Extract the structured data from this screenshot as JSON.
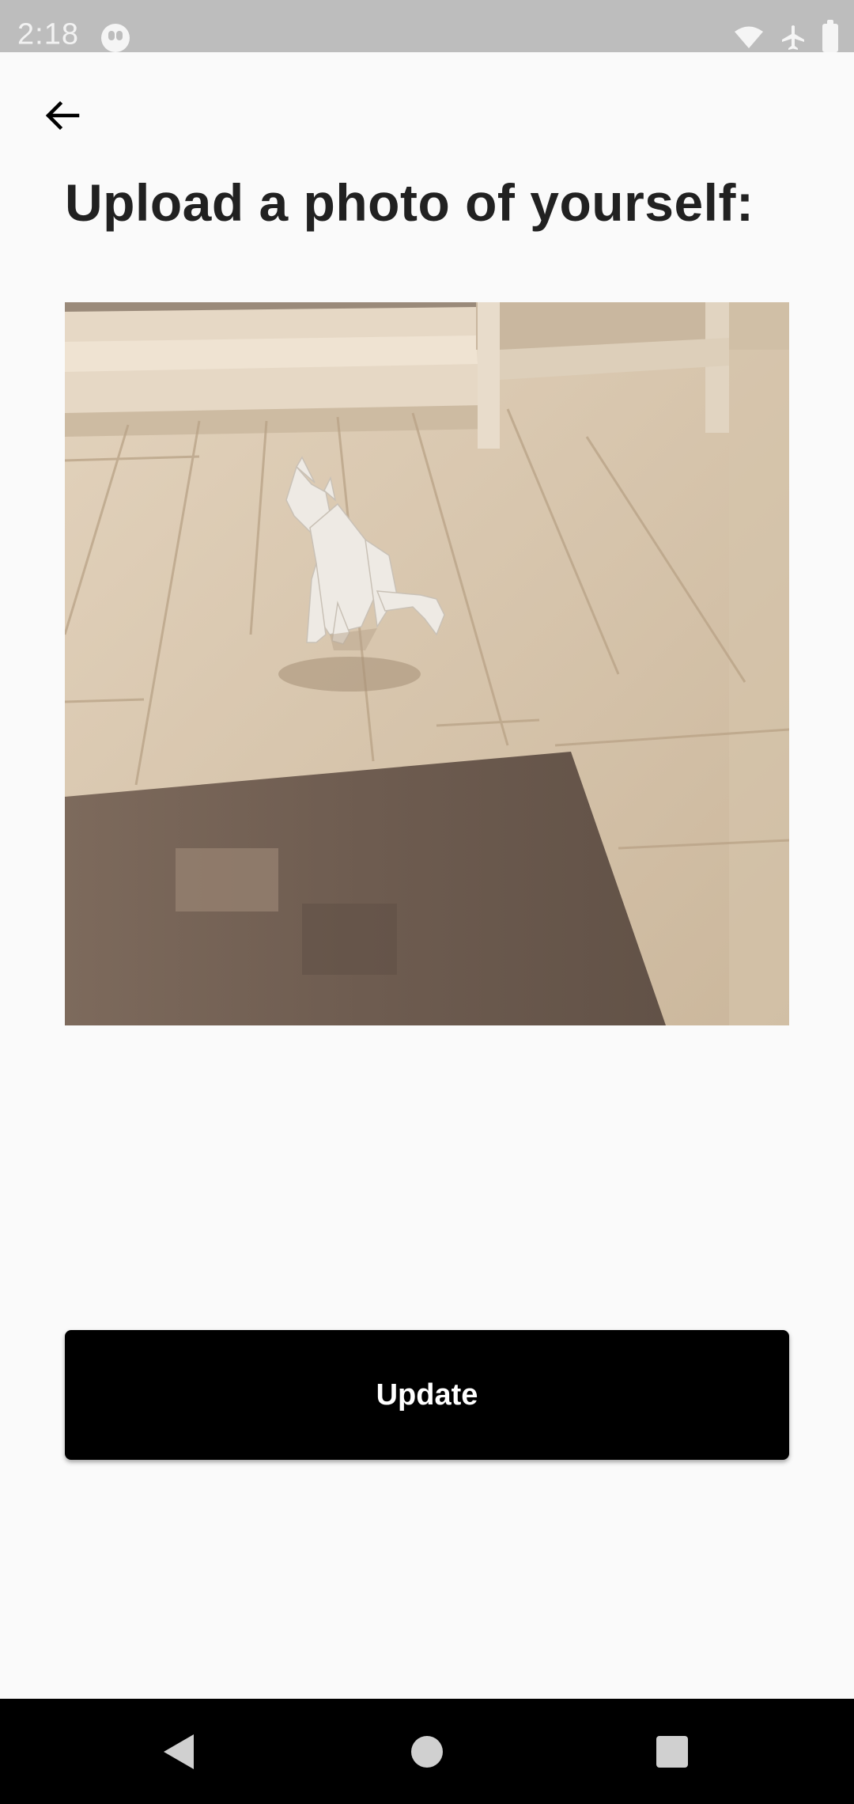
{
  "status_bar": {
    "time": "2:18",
    "icons": [
      "app-notification-icon",
      "wifi-icon",
      "airplane-mode-icon",
      "battery-icon"
    ]
  },
  "header": {
    "back_icon": "arrow-back-icon"
  },
  "main": {
    "title": "Upload a photo of yourself:",
    "photo": {
      "alt": "Low-poly white cat figurine sitting on a wooden floor",
      "description_icon": "photo-preview"
    },
    "update_button_label": "Update"
  },
  "nav_bar": {
    "buttons": [
      "nav-back-icon",
      "nav-home-icon",
      "nav-recents-icon"
    ]
  },
  "colors": {
    "background": "#fafafa",
    "title": "#212121",
    "button_bg": "#000000",
    "button_text": "#ffffff",
    "status_bar": "#bdbdbd",
    "nav_bar": "#000000"
  }
}
